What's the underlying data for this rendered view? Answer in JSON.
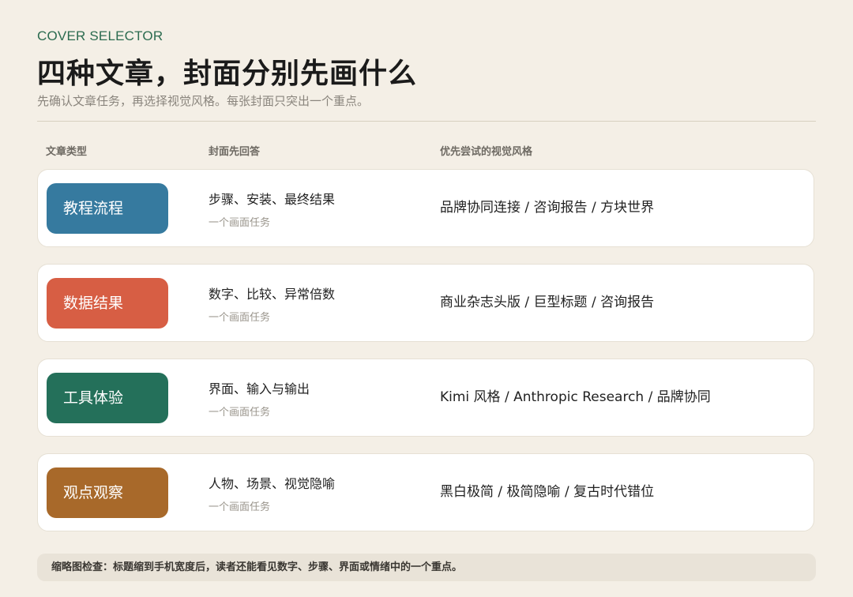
{
  "eyebrow": "COVER SELECTOR",
  "title": "四种文章，封面分别先画什么",
  "subtitle": "先确认文章任务，再选择视觉风格。每张封面只突出一个重点。",
  "columns": [
    "文章类型",
    "封面先回答",
    "优先尝试的视觉风格"
  ],
  "rows": [
    {
      "type": "教程流程",
      "color": "#367a9f",
      "answer": "步骤、安装、最终结果",
      "answer_sub": "一个画面任务",
      "styles": "品牌协同连接 / 咨询报告 / 方块世界"
    },
    {
      "type": "数据结果",
      "color": "#d75e44",
      "answer": "数字、比较、异常倍数",
      "answer_sub": "一个画面任务",
      "styles": "商业杂志头版 / 巨型标题 / 咨询报告"
    },
    {
      "type": "工具体验",
      "color": "#24705a",
      "answer": "界面、输入与输出",
      "answer_sub": "一个画面任务",
      "styles": "Kimi 风格 / Anthropic Research / 品牌协同"
    },
    {
      "type": "观点观察",
      "color": "#a8692a",
      "answer": "人物、场景、视觉隐喻",
      "answer_sub": "一个画面任务",
      "styles": "黑白极简 / 极简隐喻 / 复古时代错位"
    }
  ],
  "footer": "缩略图检查：标题缩到手机宽度后，读者还能看见数字、步骤、界面或情绪中的一个重点。"
}
